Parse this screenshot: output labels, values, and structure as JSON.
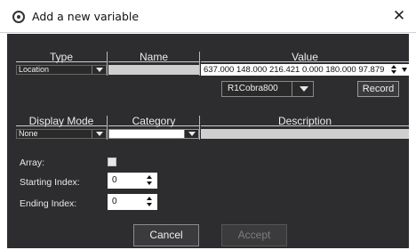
{
  "window": {
    "title": "Add a new variable",
    "close_glyph": "✕"
  },
  "headers": {
    "type": "Type",
    "name": "Name",
    "value": "Value",
    "display_mode": "Display Mode",
    "category": "Category",
    "description": "Description"
  },
  "type_combo": {
    "selected": "Location"
  },
  "name_field": {
    "value": ""
  },
  "value_field": {
    "value": "637.000 148.000 216.421 0.000 180.000 97.879"
  },
  "robot_combo": {
    "selected": "R1Cobra800"
  },
  "record_button": {
    "label": "Record"
  },
  "display_mode_combo": {
    "selected": "None"
  },
  "category_combo": {
    "selected": ""
  },
  "description_field": {
    "value": ""
  },
  "array": {
    "label": "Array:",
    "checked": false
  },
  "starting_index": {
    "label": "Starting Index:",
    "value": "0"
  },
  "ending_index": {
    "label": "Ending Index:",
    "value": "0"
  },
  "buttons": {
    "cancel": "Cancel",
    "accept": "Accept"
  },
  "colors": {
    "dialog_bg": "#2d2d30",
    "title_bg": "#ffffff",
    "disabled_text": "#7d7d7d"
  },
  "icons": [
    "app-icon",
    "close-icon",
    "chevron-down-icon",
    "spinner-icon"
  ]
}
